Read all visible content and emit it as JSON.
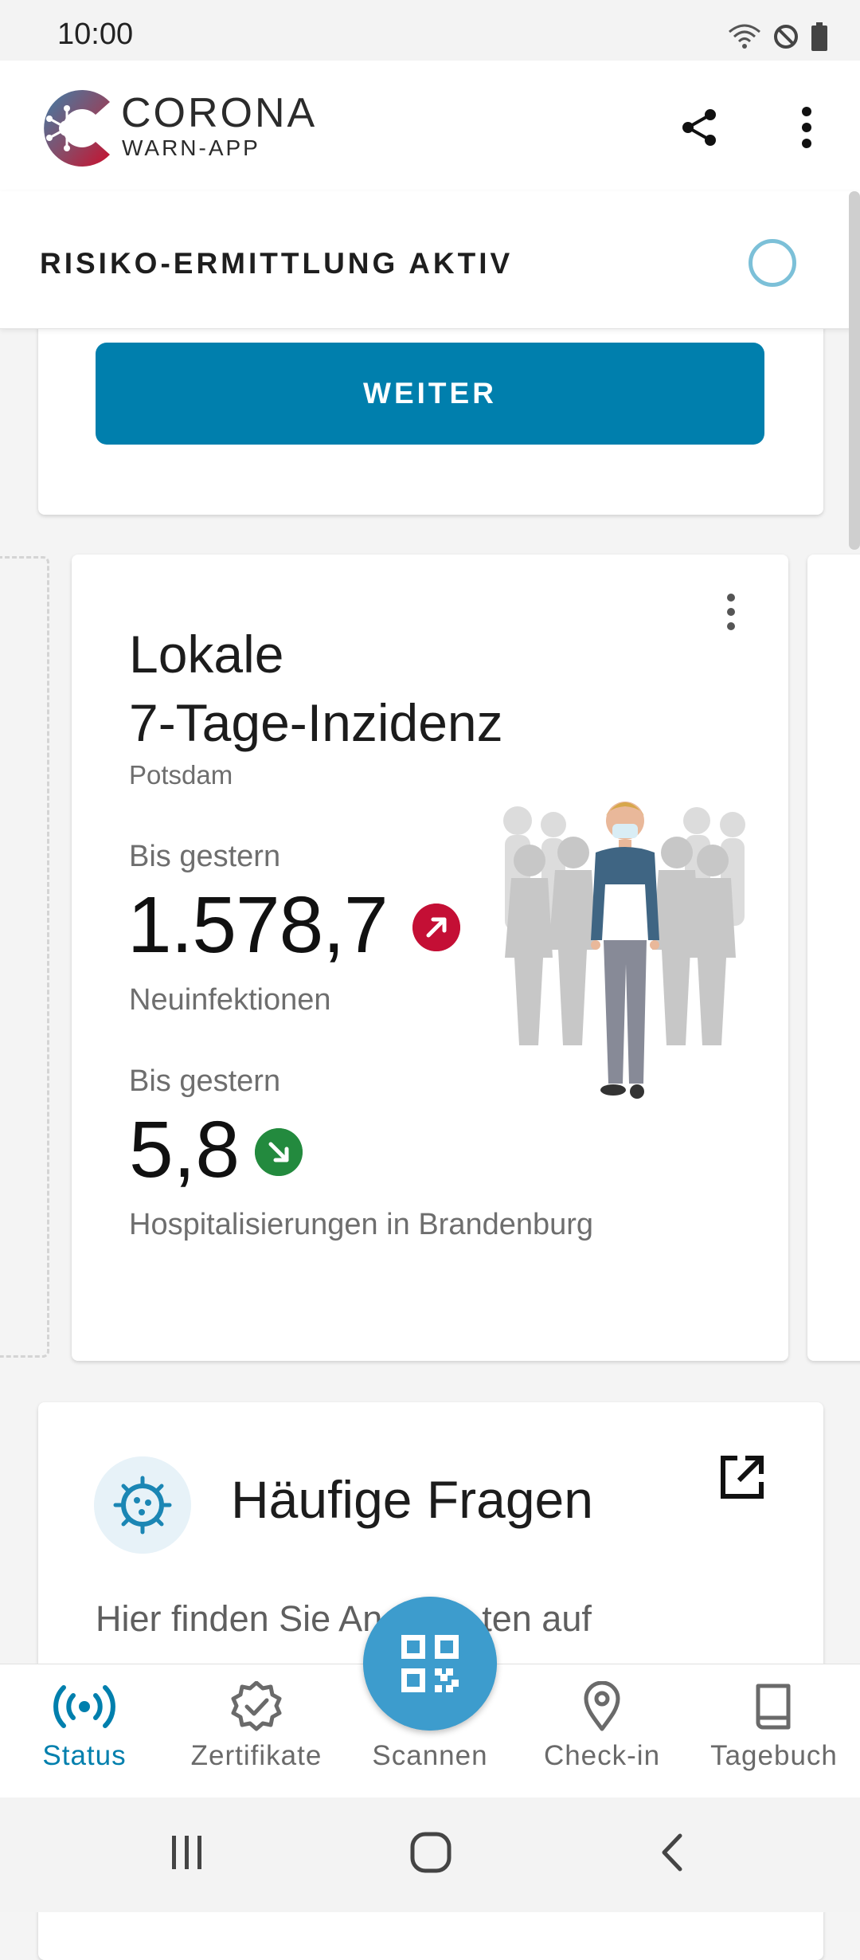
{
  "status_bar": {
    "time": "10:00"
  },
  "app": {
    "brand_line1": "CORONA",
    "brand_line2": "WARN-APP"
  },
  "risk_bar": {
    "label": "RISIKO-ERMITTLUNG AKTIV"
  },
  "top_card": {
    "button_label": "WEITER"
  },
  "incidence_card": {
    "title_line1": "Lokale",
    "title_line2": "7-Tage-Inzidenz",
    "location": "Potsdam",
    "metric1_label": "Bis gestern",
    "metric1_value": "1.578,7",
    "metric1_trend": "up",
    "metric1_sub": "Neuinfektionen",
    "metric2_label": "Bis gestern",
    "metric2_value": "5,8",
    "metric2_trend": "down",
    "metric2_sub": "Hospitalisierungen in Brandenburg"
  },
  "faq_card": {
    "title": "Häufige Fragen",
    "text_visible": "Hier finden Sie An          ten auf"
  },
  "bottom_nav": {
    "items": [
      {
        "label": "Status",
        "icon": "status-icon",
        "active": true
      },
      {
        "label": "Zertifikate",
        "icon": "certificate-icon",
        "active": false
      },
      {
        "label": "Scannen",
        "icon": "qr-code-icon",
        "active": false
      },
      {
        "label": "Check-in",
        "icon": "location-pin-icon",
        "active": false
      },
      {
        "label": "Tagebuch",
        "icon": "book-icon",
        "active": false
      }
    ]
  },
  "colors": {
    "primary": "#007fad",
    "fab": "#3d9ccd",
    "trend_up": "#c40f35",
    "trend_down": "#238a3e",
    "spinner": "#7cc0d8"
  }
}
